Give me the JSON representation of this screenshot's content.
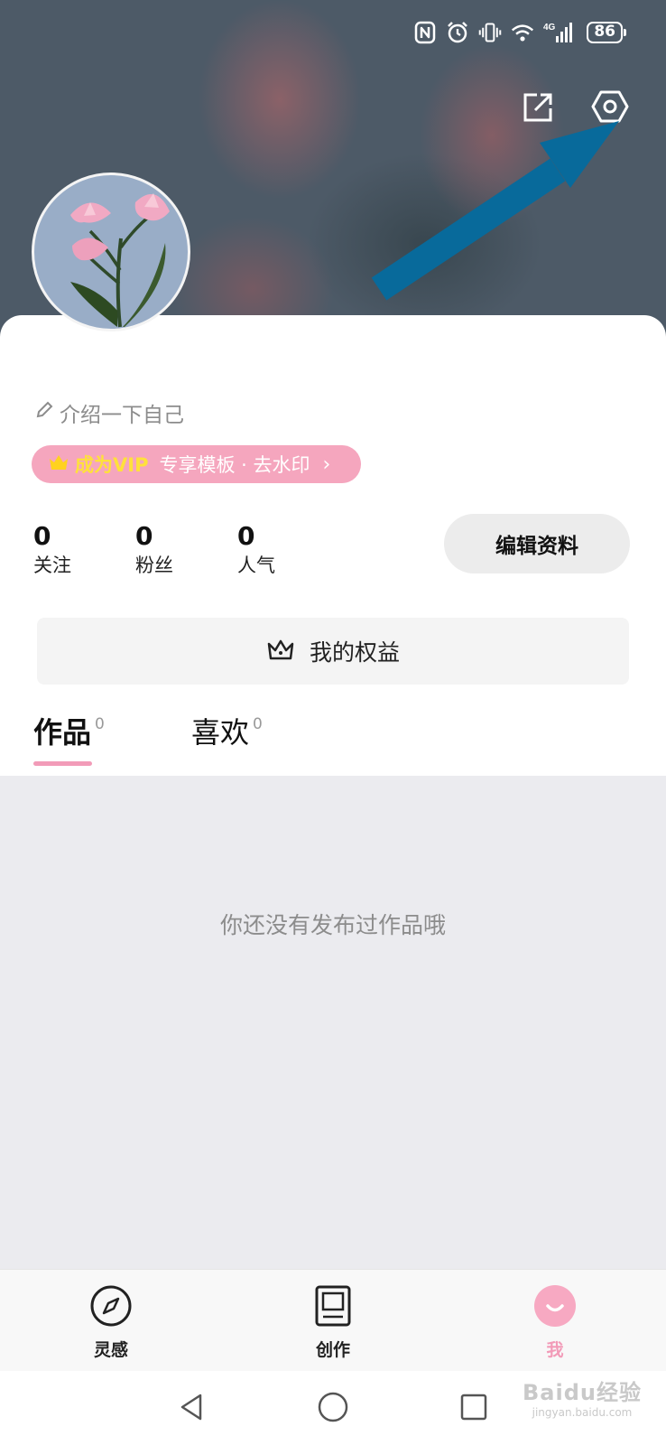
{
  "status_bar": {
    "battery": "86",
    "network_label": "4G",
    "icons": [
      "nfc-icon",
      "alarm-icon",
      "vibrate-icon",
      "wifi-icon",
      "signal-icon",
      "battery-icon"
    ]
  },
  "header": {
    "share_icon": "share-icon",
    "settings_icon": "settings-icon"
  },
  "profile": {
    "bio_placeholder": "介绍一下自己",
    "vip_title": "成为VIP",
    "vip_desc": "专享模板 · 去水印",
    "stats": [
      {
        "value": "0",
        "label": "关注"
      },
      {
        "value": "0",
        "label": "粉丝"
      },
      {
        "value": "0",
        "label": "人气"
      }
    ],
    "edit_button": "编辑资料",
    "benefits_label": "我的权益"
  },
  "tabs": [
    {
      "label": "作品",
      "count": "0",
      "active": true
    },
    {
      "label": "喜欢",
      "count": "0",
      "active": false
    }
  ],
  "empty_state": "你还没有发布过作品哦",
  "bottom_nav": [
    {
      "label": "灵感",
      "icon": "compass-icon",
      "active": false
    },
    {
      "label": "创作",
      "icon": "create-icon",
      "active": false
    },
    {
      "label": "我",
      "icon": "me-icon",
      "active": true
    }
  ],
  "colors": {
    "accent_pink": "#f29bb8",
    "vip_gold": "#ffe13b",
    "annotation_arrow": "#086a9b"
  },
  "watermark": {
    "main": "Baidu经验",
    "sub": "jingyan.baidu.com"
  }
}
